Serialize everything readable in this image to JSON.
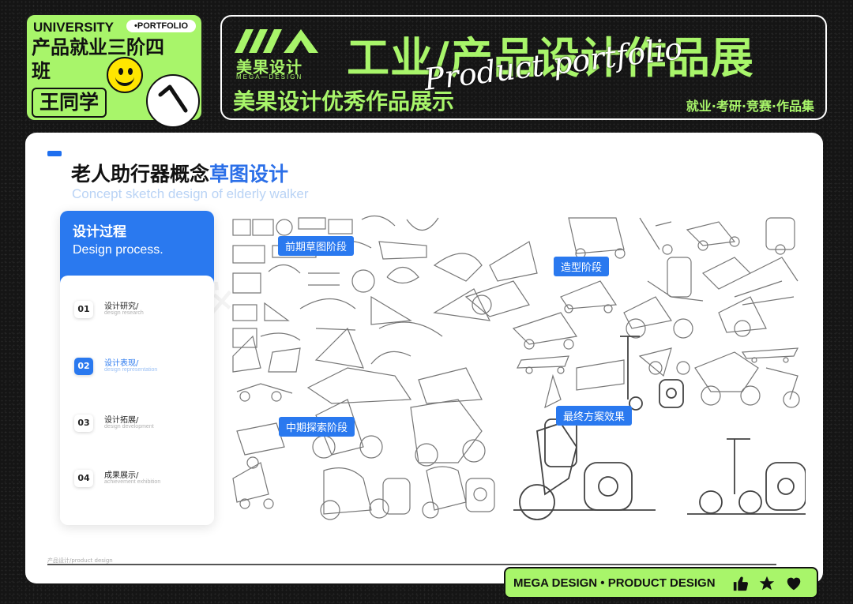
{
  "header": {
    "university": "UNIVERSITY",
    "portfolio_tag": "•PORTFOLIO",
    "class_name": "产品就业三阶四班",
    "student_name": "王同学",
    "brand_cn": "美果设计",
    "brand_en": "MEGA—DESIGN",
    "main_title": "工业/产品设计作品展",
    "script_title": "Product portfolio",
    "subtitle": "美果设计优秀作品展示",
    "tags": "就业·考研·竞赛·作品集"
  },
  "card": {
    "title_prefix": "老人助行器概念",
    "title_highlight": "草图设计",
    "title_en": "Concept sketch design of elderly walker",
    "process": {
      "title_cn": "设计过程",
      "title_en": "Design process.",
      "steps": [
        {
          "num": "01",
          "cn": "设计研究/",
          "en": "design research"
        },
        {
          "num": "02",
          "cn": "设计表现/",
          "en": "design representation"
        },
        {
          "num": "03",
          "cn": "设计拓展/",
          "en": "design development"
        },
        {
          "num": "04",
          "cn": "成果展示/",
          "en": "achievement exhibition"
        }
      ]
    },
    "stages": [
      "前期草图阶段",
      "造型阶段",
      "中期探索阶段",
      "最终方案效果"
    ],
    "footer": "产品设计/product design"
  },
  "watermark": "美果设计",
  "bottom_bar": {
    "text": "MEGA DESIGN • PRODUCT DESIGN",
    "icons": [
      "thumbs-up-icon",
      "star-icon",
      "heart-icon"
    ]
  },
  "colors": {
    "accent_green": "#a8f56a",
    "accent_blue": "#2a79ef",
    "background": "#151515"
  }
}
